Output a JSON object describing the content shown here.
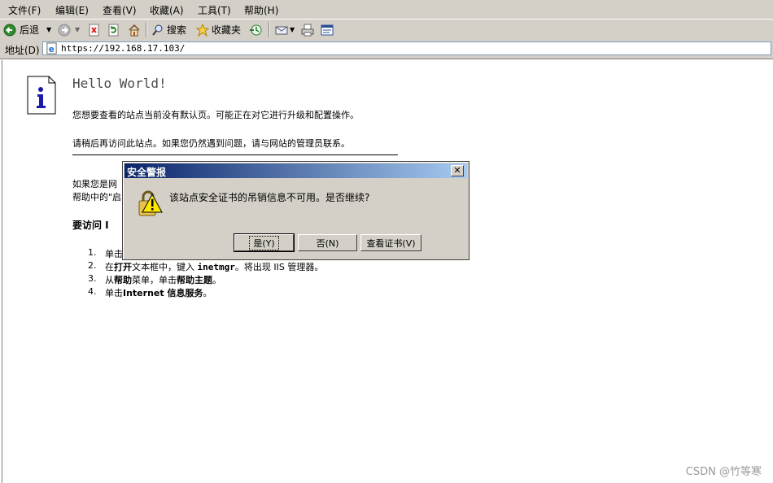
{
  "menu": [
    {
      "label": "文件(F)"
    },
    {
      "label": "编辑(E)"
    },
    {
      "label": "查看(V)"
    },
    {
      "label": "收藏(A)"
    },
    {
      "label": "工具(T)"
    },
    {
      "label": "帮助(H)"
    }
  ],
  "toolbar": {
    "back_label": "后退",
    "search_label": "搜索",
    "favorites_label": "收藏夹"
  },
  "address": {
    "label": "地址(D)",
    "url": "https://192.168.17.103/"
  },
  "page": {
    "title": "Hello World!",
    "line1": "您想要查看的站点当前没有默认页。可能正在对它进行升级和配置操作。",
    "line2": "请稍后再访问此站点。如果您仍然遇到问题，请与网站的管理员联系。",
    "line3": "如果您是网",
    "line4": "帮助中的\"启",
    "howto": "要访问 I",
    "steps": [
      {
        "num": "1.",
        "text": "单击"
      },
      {
        "num": "2.",
        "text_a": "在",
        "text_b": "打开",
        "text_c": "文本框中，键入 ",
        "text_d": "inetmgr",
        "text_e": "。将出现 IIS 管理器。"
      },
      {
        "num": "3.",
        "text_a": "从",
        "text_b": "帮助",
        "text_c": "菜单，单击",
        "text_d": "帮助主题",
        "text_e": "。"
      },
      {
        "num": "4.",
        "text_a": "单击",
        "text_b": "Internet 信息服务",
        "text_c": "。"
      }
    ]
  },
  "dialog": {
    "title": "安全警报",
    "close": "✕",
    "message": "该站点安全证书的吊销信息不可用。是否继续?",
    "yes": "是(Y)",
    "no": "否(N)",
    "view_cert": "查看证书(V)"
  },
  "watermark": "CSDN @竹等寒",
  "colors": {
    "title_gradient_start": "#0a246a",
    "title_gradient_end": "#a6caf0",
    "chrome": "#d4d0c8"
  }
}
